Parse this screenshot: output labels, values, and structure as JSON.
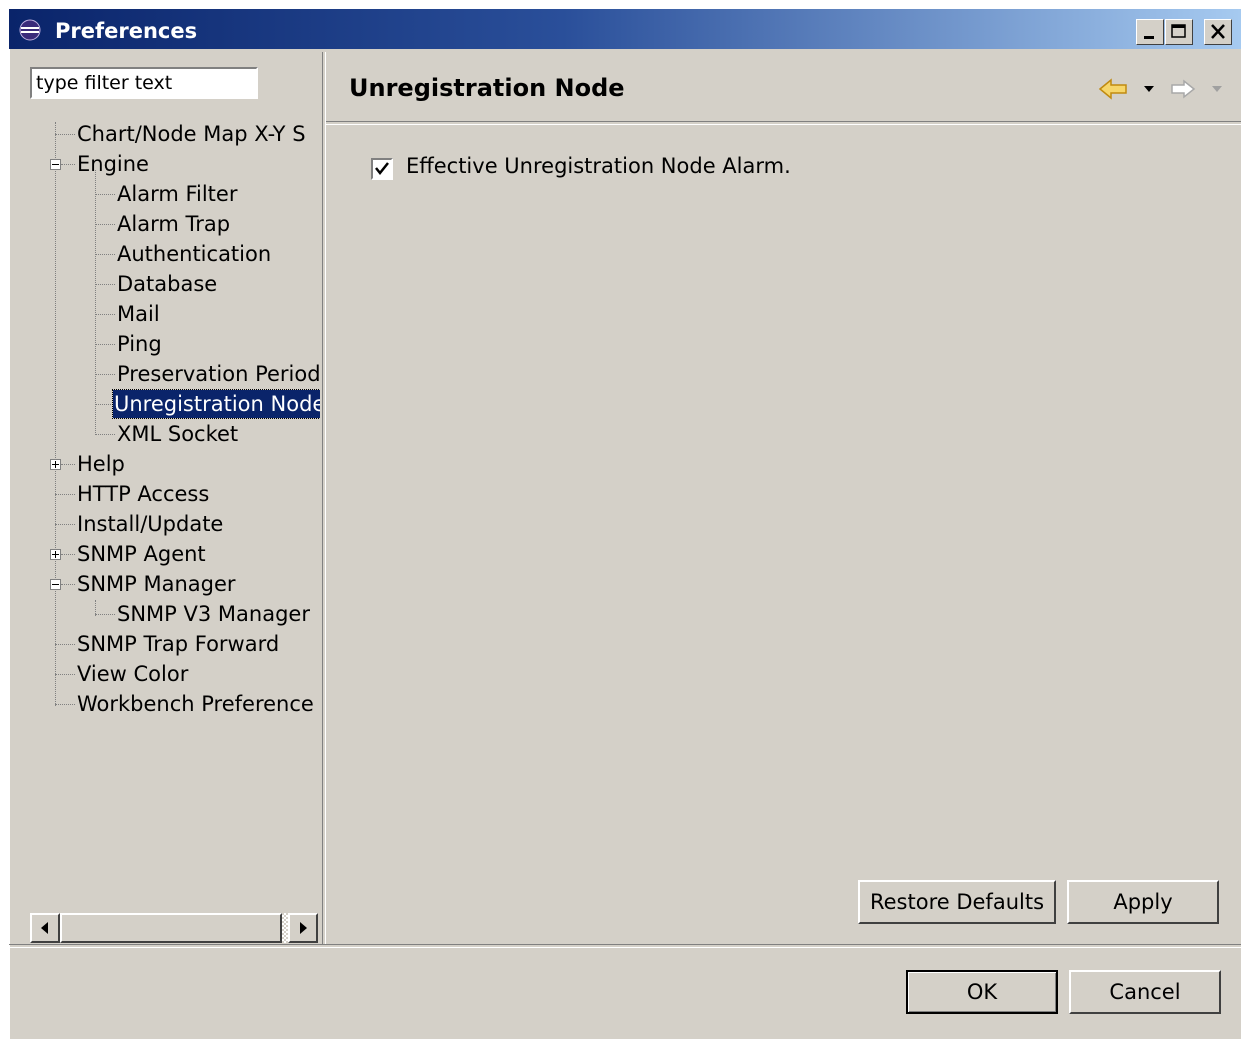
{
  "window": {
    "title": "Preferences"
  },
  "filter": {
    "placeholder": "type filter text"
  },
  "tree": {
    "items": [
      {
        "label": "Chart/Node Map X-Y S"
      },
      {
        "label": "Engine",
        "expanded": true
      },
      {
        "label": "Alarm Filter"
      },
      {
        "label": "Alarm Trap"
      },
      {
        "label": "Authentication"
      },
      {
        "label": "Database"
      },
      {
        "label": "Mail"
      },
      {
        "label": "Ping"
      },
      {
        "label": "Preservation Period"
      },
      {
        "label": "Unregistration Node",
        "selected": true
      },
      {
        "label": "XML Socket"
      },
      {
        "label": "Help",
        "expanded": false
      },
      {
        "label": "HTTP Access"
      },
      {
        "label": "Install/Update"
      },
      {
        "label": "SNMP Agent",
        "expanded": false
      },
      {
        "label": "SNMP Manager",
        "expanded": true
      },
      {
        "label": "SNMP V3 Manager"
      },
      {
        "label": "SNMP Trap Forward"
      },
      {
        "label": "View Color"
      },
      {
        "label": "Workbench  Preference"
      }
    ]
  },
  "page": {
    "title": "Unregistration Node",
    "checkbox_label": "Effective Unregistration Node Alarm.",
    "checkbox_checked": true
  },
  "buttons": {
    "restore_defaults": "Restore Defaults",
    "apply": "Apply",
    "ok": "OK",
    "cancel": "Cancel"
  },
  "colors": {
    "selection": "#0a246a",
    "face": "#d4d0c8",
    "back_arrow": "#f0c040"
  }
}
